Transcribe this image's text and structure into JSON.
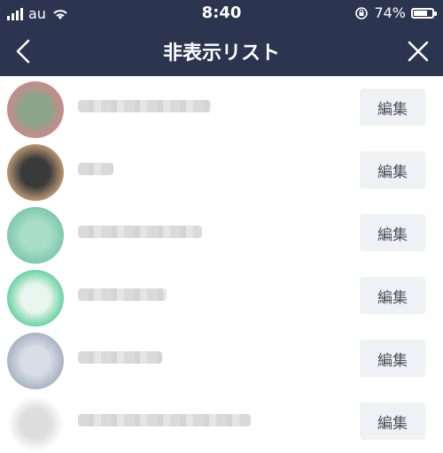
{
  "status_bar": {
    "carrier": "au",
    "time": "8:40",
    "battery": "74%",
    "battery_level": 0.74
  },
  "nav": {
    "title": "非表示リスト",
    "back_icon": "chevron-left-icon",
    "close_icon": "close-icon"
  },
  "rows": [
    {
      "name": "",
      "edit_label": "編集",
      "avatar_colors": [
        "#c98a8a",
        "#8aa58a"
      ]
    },
    {
      "name": "",
      "edit_label": "編集",
      "avatar_colors": [
        "#b89470",
        "#3a3a3a"
      ]
    },
    {
      "name": "",
      "edit_label": "編集",
      "avatar_colors": [
        "#7ec9ad",
        "#a9ddc8"
      ]
    },
    {
      "name": "",
      "edit_label": "編集",
      "avatar_colors": [
        "#6ad3a4",
        "#e9f5ee"
      ]
    },
    {
      "name": "",
      "edit_label": "編集",
      "avatar_colors": [
        "#aab3c4",
        "#d8dde6"
      ]
    },
    {
      "name": "",
      "edit_label": "編集",
      "avatar_colors": [
        "#ffffff",
        "#dddddd"
      ]
    }
  ]
}
